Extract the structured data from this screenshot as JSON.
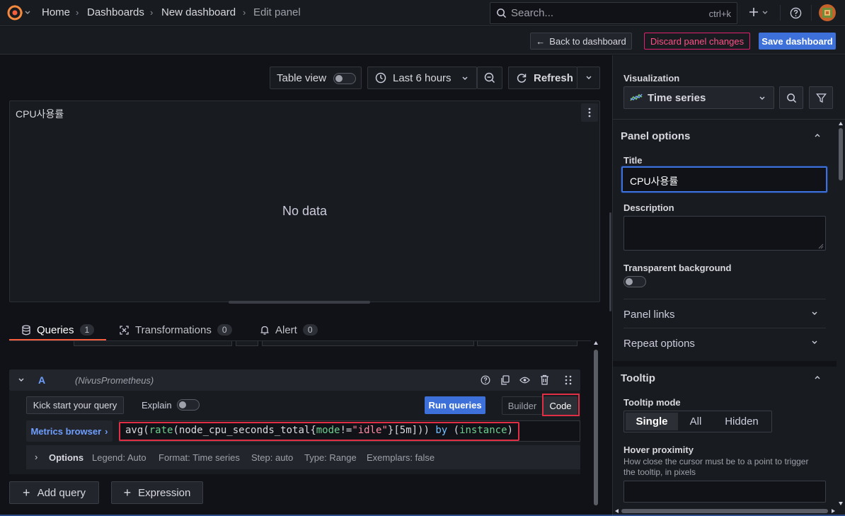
{
  "breadcrumb": {
    "home": "Home",
    "dashboards": "Dashboards",
    "new_dashboard": "New dashboard",
    "current": "Edit panel"
  },
  "search": {
    "placeholder": "Search...",
    "shortcut": "ctrl+k"
  },
  "actions": {
    "back": "Back to dashboard",
    "discard": "Discard panel changes",
    "save": "Save dashboard"
  },
  "toolbar": {
    "table_view": "Table view",
    "time_range": "Last 6 hours",
    "refresh": "Refresh"
  },
  "panel": {
    "title": "CPU사용률",
    "empty_message": "No data"
  },
  "tabs": [
    {
      "label": "Queries",
      "count": "1"
    },
    {
      "label": "Transformations",
      "count": "0"
    },
    {
      "label": "Alert",
      "count": "0"
    }
  ],
  "query": {
    "ref_id": "A",
    "datasource": "(NivusPrometheus)",
    "kick_start": "Kick start your query",
    "explain": "Explain",
    "run": "Run queries",
    "builder": "Builder",
    "code": "Code",
    "metrics_browser": "Metrics browser",
    "expr_parts": {
      "fn1": "avg",
      "p1": "(",
      "fn2": "rate",
      "p2": "(node_cpu_seconds_total{",
      "label": "mode",
      "op": "!=",
      "value": "\"idle\"",
      "p3": "}[5m])) ",
      "kw": "by",
      "p4": " (",
      "group": "instance",
      "p5": ")"
    },
    "options": {
      "label": "Options",
      "legend": "Legend: Auto",
      "format": "Format: Time series",
      "step": "Step: auto",
      "type": "Type: Range",
      "exemplars": "Exemplars: false"
    }
  },
  "add_query": "Add query",
  "expression": "Expression",
  "sidebar": {
    "visualization_label": "Visualization",
    "visualization_value": "Time series",
    "panel_options": "Panel options",
    "title_label": "Title",
    "title_value": "CPU사용률",
    "description_label": "Description",
    "transparent_label": "Transparent background",
    "panel_links": "Panel links",
    "repeat_options": "Repeat options",
    "tooltip": "Tooltip",
    "tooltip_mode_label": "Tooltip mode",
    "tooltip_modes": [
      "Single",
      "All",
      "Hidden"
    ],
    "hover_label": "Hover proximity",
    "hover_desc": "How close the cursor must be to a point to trigger the tooltip, in pixels"
  },
  "colors": {
    "accent": "#f55f3e",
    "primary": "#3d71d9",
    "danger": "#ff5286",
    "highlight": "#e02f44"
  }
}
